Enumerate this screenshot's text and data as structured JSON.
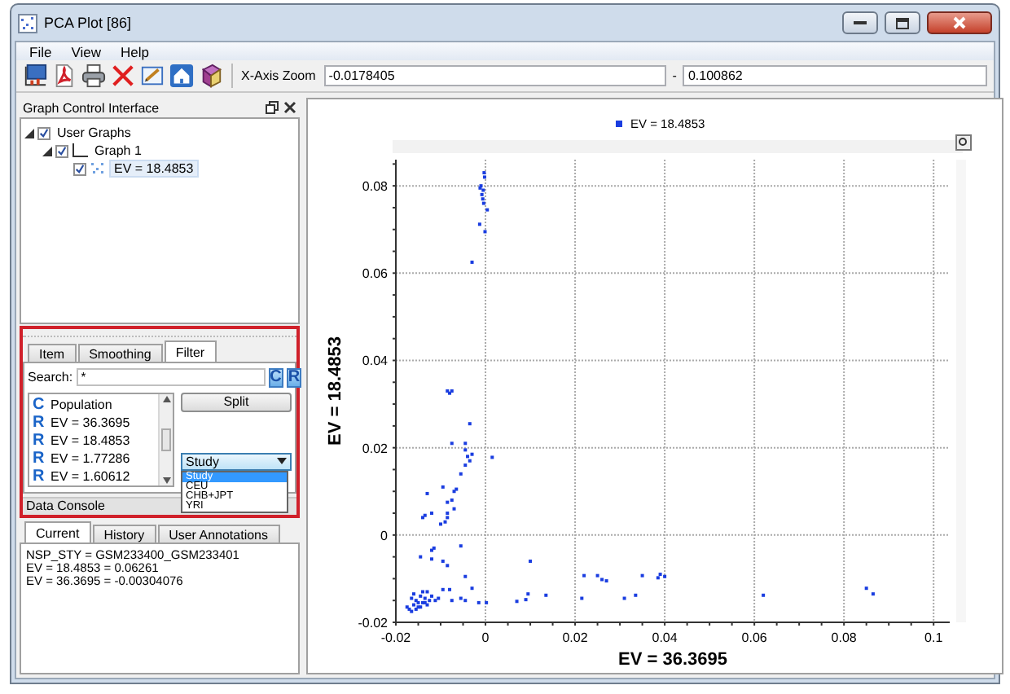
{
  "window": {
    "title": "PCA Plot [86]"
  },
  "menu": [
    "File",
    "View",
    "Help"
  ],
  "x_axis_zoom": {
    "label": "X-Axis Zoom",
    "min": "-0.0178405",
    "separator": "-",
    "max": "0.100862"
  },
  "graph_control": {
    "title": "Graph Control Interface",
    "tree": [
      {
        "label": "User Graphs",
        "checked": true,
        "expanded": true,
        "selected": false,
        "children": [
          {
            "label": "Graph 1",
            "checked": true,
            "expanded": true,
            "selected": false,
            "children": [
              {
                "label": "EV = 18.4853",
                "checked": true,
                "selected": true
              }
            ]
          }
        ]
      }
    ]
  },
  "filter_panel": {
    "tabs": [
      {
        "label": "Item",
        "selected": false
      },
      {
        "label": "Smoothing",
        "selected": false
      },
      {
        "label": "Filter",
        "selected": true
      }
    ],
    "search": {
      "label": "Search:",
      "value": "*"
    },
    "search_buttons": [
      "C",
      "R"
    ],
    "list": [
      {
        "marker": "C",
        "label": "Population"
      },
      {
        "marker": "R",
        "label": "EV = 36.3695"
      },
      {
        "marker": "R",
        "label": "EV = 18.4853"
      },
      {
        "marker": "R",
        "label": "EV = 1.77286"
      },
      {
        "marker": "R",
        "label": "EV = 1.60612"
      }
    ],
    "split_button": "Split",
    "dropdown": {
      "value": "Study",
      "expanded": true,
      "options": [
        {
          "label": "Study",
          "selected": true
        },
        {
          "label": "CEU",
          "selected": false
        },
        {
          "label": "CHB+JPT",
          "selected": false
        },
        {
          "label": "YRI",
          "selected": false
        }
      ]
    }
  },
  "data_console": {
    "title": "Data Console",
    "tabs": [
      {
        "label": "Current",
        "selected": true
      },
      {
        "label": "History",
        "selected": false
      },
      {
        "label": "User Annotations",
        "selected": false
      }
    ],
    "lines": [
      "NSP_STY = GSM233400_GSM233401",
      "EV = 18.4853 = 0.06261",
      "EV = 36.3695 = -0.00304076"
    ]
  },
  "plot": {
    "chart_data": {
      "type": "scatter",
      "xlabel": "EV = 36.3695",
      "ylabel": "EV = 18.4853",
      "grid": true,
      "xlim": [
        -0.02,
        0.1036
      ],
      "ylim": [
        -0.02,
        0.086
      ],
      "xticks": [
        -0.02,
        0,
        0.02,
        0.04,
        0.06,
        0.08,
        0.1
      ],
      "yticks": [
        -0.02,
        0,
        0.02,
        0.04,
        0.06,
        0.08
      ],
      "x": [
        -0.0003,
        -0.0002,
        -0.001,
        -0.0005,
        -0.0012,
        -0.0008,
        -0.0006,
        -0.0004,
        0.0004,
        -0.0013,
        -0.0001,
        -0.003,
        -0.0085,
        -0.008,
        -0.0075,
        -0.0035,
        -0.0075,
        -0.0045,
        -0.0045,
        -0.004,
        -0.003,
        -0.0035,
        0.0015,
        -0.0045,
        -0.0055,
        -0.0065,
        -0.007,
        -0.0095,
        -0.013,
        -0.0075,
        -0.0085,
        -0.007,
        -0.0085,
        -0.0085,
        -0.012,
        -0.014,
        -0.0135,
        -0.01,
        -0.009,
        -0.0055,
        -0.0115,
        -0.012,
        -0.0145,
        -0.0095,
        -0.012,
        -0.0085,
        -0.0045,
        -0.003,
        0.01,
        0.022,
        0.025,
        0.026,
        0.027,
        0.035,
        0.0385,
        0.039,
        0.04,
        0.062,
        0.085,
        0.0865,
        0.0095,
        0.0135,
        0.0215,
        0.031,
        0.0335,
        0.007,
        0.009,
        -0.0015,
        0.0002,
        -0.0045,
        -0.0055,
        -0.008,
        -0.0095,
        -0.0075,
        -0.0175,
        -0.017,
        -0.0165,
        -0.016,
        -0.0155,
        -0.015,
        -0.0145,
        -0.014,
        -0.0135,
        -0.013,
        -0.0125,
        -0.012,
        -0.0165,
        -0.016,
        -0.0155,
        -0.015,
        -0.0145,
        -0.014,
        -0.0135,
        -0.013,
        -0.0112,
        -0.0105
      ],
      "series": [
        {
          "name": "EV = 18.4853",
          "color": "#1a3de0",
          "values": [
            0.083,
            0.082,
            0.08,
            0.079,
            0.0795,
            0.078,
            0.077,
            0.076,
            0.0745,
            0.0712,
            0.0695,
            0.0625,
            0.033,
            0.0325,
            0.033,
            0.0255,
            0.021,
            0.021,
            0.0195,
            0.018,
            0.0185,
            0.017,
            0.0178,
            0.016,
            0.014,
            0.0105,
            0.01,
            0.011,
            0.0095,
            0.008,
            0.0075,
            0.006,
            0.005,
            0.004,
            0.005,
            0.004,
            0.0045,
            0.0025,
            0.003,
            -0.0025,
            -0.003,
            -0.0035,
            -0.005,
            -0.006,
            -0.0055,
            -0.007,
            -0.0095,
            -0.0122,
            -0.006,
            -0.0093,
            -0.0093,
            -0.0102,
            -0.0105,
            -0.0093,
            -0.0098,
            -0.009,
            -0.0095,
            -0.0138,
            -0.0122,
            -0.0135,
            -0.0135,
            -0.0138,
            -0.0145,
            -0.0145,
            -0.0138,
            -0.0152,
            -0.0148,
            -0.0155,
            -0.0155,
            -0.015,
            -0.0145,
            -0.0125,
            -0.0125,
            -0.015,
            -0.0165,
            -0.017,
            -0.0175,
            -0.016,
            -0.015,
            -0.0165,
            -0.014,
            -0.0155,
            -0.0145,
            -0.013,
            -0.015,
            -0.014,
            -0.0145,
            -0.0135,
            -0.017,
            -0.0155,
            -0.0165,
            -0.013,
            -0.0155,
            -0.016,
            -0.015,
            -0.0145
          ]
        }
      ]
    }
  }
}
